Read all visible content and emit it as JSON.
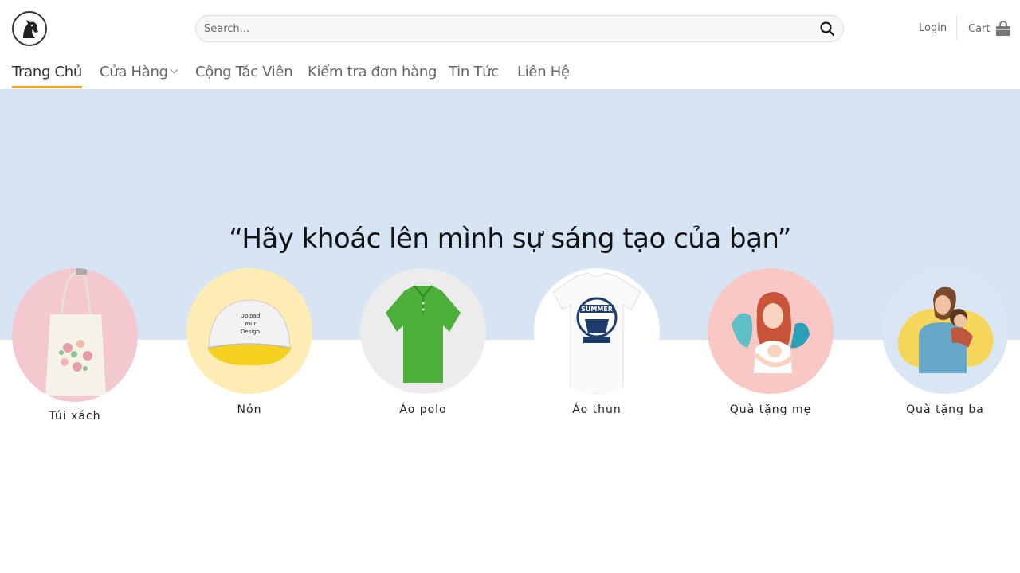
{
  "header": {
    "search_placeholder": "Search...",
    "login_label": "Login",
    "cart_label": "Cart"
  },
  "nav": {
    "items": [
      {
        "label": "Trang Chủ"
      },
      {
        "label": "Cửa Hàng"
      },
      {
        "label": "Cộng Tác Viên"
      },
      {
        "label": "Kiểm tra đơn hàng"
      },
      {
        "label": "Tin Tức"
      },
      {
        "label": "Liên Hệ"
      }
    ]
  },
  "banner": {
    "tagline": "“Hãy khoác lên mình sự sáng tạo của bạn”"
  },
  "categories": [
    {
      "label": "Túi xách"
    },
    {
      "label": "Nón",
      "cap_text": "Upload Your Design"
    },
    {
      "label": "Áo polo"
    },
    {
      "label": "Áo thun",
      "shirt_text": "SUMMER"
    },
    {
      "label": "Quà tặng mẹ"
    },
    {
      "label": "Quà tặng ba"
    }
  ],
  "colors": {
    "accent": "#f0a030",
    "banner_bg": "#d6e4f4"
  }
}
